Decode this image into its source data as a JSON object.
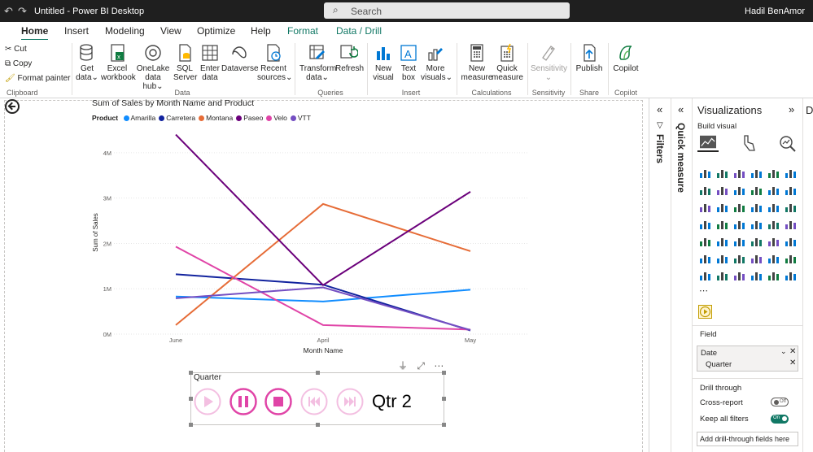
{
  "window": {
    "title": "Untitled - Power BI Desktop",
    "search_placeholder": "Search",
    "user": "Hadil BenAmor"
  },
  "ribbon": {
    "tabs": [
      {
        "label": "Home",
        "active": true
      },
      {
        "label": "Insert"
      },
      {
        "label": "Modeling"
      },
      {
        "label": "View"
      },
      {
        "label": "Optimize"
      },
      {
        "label": "Help"
      },
      {
        "label": "Format",
        "context": true
      },
      {
        "label": "Data / Drill",
        "context": true
      }
    ],
    "clipboard": {
      "cut": "Cut",
      "copy": "Copy",
      "format_painter": "Format painter",
      "group": "Clipboard"
    },
    "data": {
      "get_data": [
        "Get",
        "data"
      ],
      "excel": [
        "Excel",
        "workbook"
      ],
      "onelake": [
        "OneLake",
        "data hub"
      ],
      "sql": [
        "SQL",
        "Server"
      ],
      "enter": [
        "Enter",
        "data"
      ],
      "dataverse": [
        "Dataverse",
        ""
      ],
      "recent": [
        "Recent",
        "sources"
      ],
      "group": "Data"
    },
    "queries": {
      "transform": [
        "Transform",
        "data"
      ],
      "refresh": [
        "Refresh",
        ""
      ],
      "group": "Queries"
    },
    "insert": {
      "new_visual": [
        "New",
        "visual"
      ],
      "text_box": [
        "Text",
        "box"
      ],
      "more_visuals": [
        "More",
        "visuals"
      ],
      "group": "Insert"
    },
    "calculations": {
      "new_measure": [
        "New",
        "measure"
      ],
      "quick_measure": [
        "Quick",
        "measure"
      ],
      "group": "Calculations"
    },
    "sensitivity": {
      "button": [
        "Sensitivity",
        ""
      ],
      "group": "Sensitivity"
    },
    "share": {
      "publish": [
        "Publish",
        ""
      ],
      "group": "Share"
    },
    "copilot": {
      "button": [
        "Copilot",
        ""
      ],
      "group": "Copilot"
    }
  },
  "legend": {
    "title": "Product",
    "entries": [
      {
        "name": "Amarilla",
        "color": "#118dff"
      },
      {
        "name": "Carretera",
        "color": "#12239e"
      },
      {
        "name": "Montana",
        "color": "#e66c37"
      },
      {
        "name": "Paseo",
        "color": "#6b007b"
      },
      {
        "name": "Velo",
        "color": "#e044a7"
      },
      {
        "name": "VTT",
        "color": "#744ec2"
      }
    ]
  },
  "chart_data": {
    "type": "line",
    "title": "Sum of Sales by Month Name and Product",
    "xlabel": "Month Name",
    "ylabel": "Sum of Sales",
    "categories": [
      "June",
      "April",
      "May"
    ],
    "ylim": [
      0,
      4500000
    ],
    "yticks": [
      {
        "value": 0,
        "label": "0M"
      },
      {
        "value": 1000000,
        "label": "1M"
      },
      {
        "value": 2000000,
        "label": "2M"
      },
      {
        "value": 3000000,
        "label": "3M"
      },
      {
        "value": 4000000,
        "label": "4M"
      }
    ],
    "grid": true,
    "legend_position": "top-left",
    "series": [
      {
        "name": "Amarilla",
        "values": [
          830000,
          720000,
          980000
        ]
      },
      {
        "name": "Carretera",
        "values": [
          1320000,
          1090000,
          80000
        ]
      },
      {
        "name": "Montana",
        "values": [
          200000,
          2870000,
          1830000
        ]
      },
      {
        "name": "Paseo",
        "values": [
          4400000,
          1080000,
          3140000
        ]
      },
      {
        "name": "Velo",
        "values": [
          1930000,
          200000,
          100000
        ]
      },
      {
        "name": "VTT",
        "values": [
          790000,
          1030000,
          90000
        ]
      }
    ]
  },
  "play_axis": {
    "title": "Quarter",
    "current": "Qtr 2",
    "color": "#e044a7"
  },
  "panes": {
    "filters": "Filters",
    "quick_measure": "Quick measure",
    "visualizations": "Visualizations",
    "build_visual": "Build visual",
    "field_label": "Field",
    "field_table": "Date",
    "field_item": "Quarter",
    "drill_through": "Drill through",
    "cross_report": "Cross-report",
    "cross_report_state": "Off",
    "keep_filters": "Keep all filters",
    "keep_filters_state": "On",
    "add_drill": "Add drill-through fields here",
    "next_pane": "D"
  }
}
